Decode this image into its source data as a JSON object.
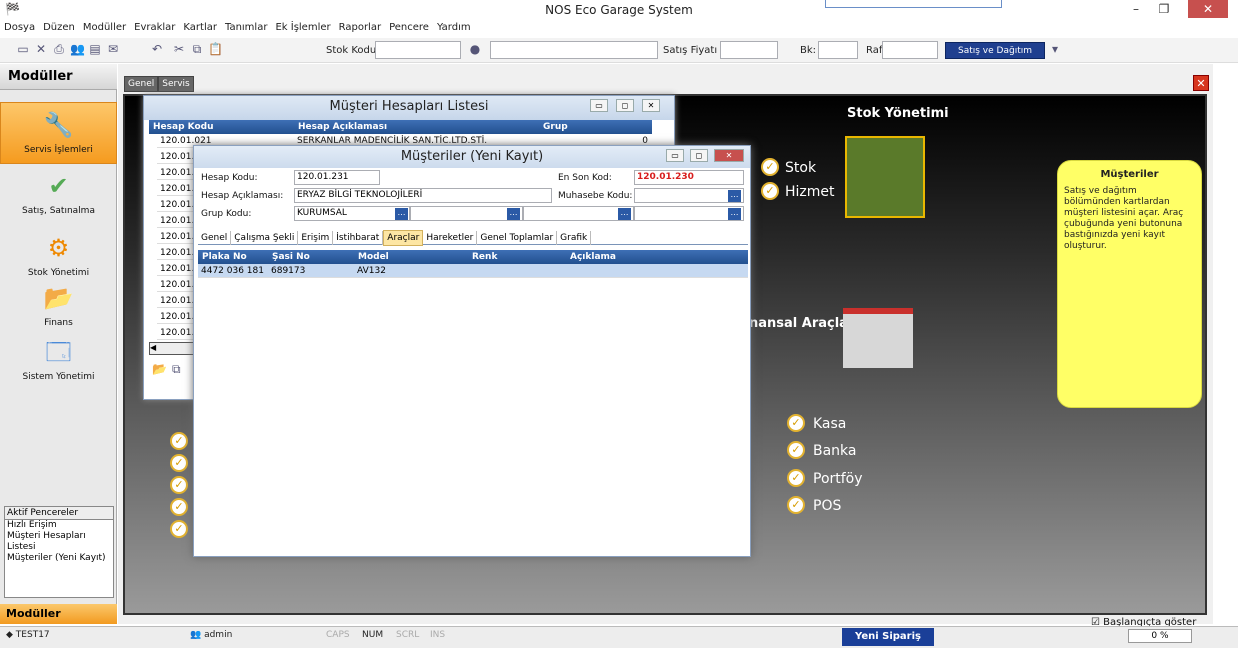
{
  "title": "NOS Eco Garage System",
  "menu": [
    "Dosya",
    "Düzen",
    "Modüller",
    "Evraklar",
    "Kartlar",
    "Tanımlar",
    "Ek İşlemler",
    "Raporlar",
    "Pencere",
    "Yardım"
  ],
  "toolbar": {
    "stok_kodu": "Stok Kodu",
    "satis_fiyati": "Satış Fiyatı",
    "bk": "Bk:",
    "raf": "Raf",
    "satis_dagitim": "Satış ve Dağıtım"
  },
  "sidebar": {
    "header": "Modüller",
    "items": [
      {
        "label": "Servis İşlemleri"
      },
      {
        "label": "Satış, Satınalma"
      },
      {
        "label": "Stok Yönetimi"
      },
      {
        "label": "Finans"
      },
      {
        "label": "Sistem Yönetimi"
      }
    ],
    "aktif_header": "Aktif Pencereler",
    "aktif_items": [
      "Hızlı Erişim",
      "Müşteri Hesapları Listesi",
      "Müşteriler (Yeni Kayıt)"
    ],
    "footer": "Modüller"
  },
  "tabs": [
    "Genel",
    "Servis"
  ],
  "dashboard": {
    "stok_title": "Stok Yönetimi",
    "stok_items": [
      "Stok",
      "Hizmet"
    ],
    "finans_title": "nansal Araçlar",
    "finans_items": [
      "Kasa",
      "Banka",
      "Portföy",
      "POS"
    ],
    "note_title": "Müşteriler",
    "note_body": "Satış ve dağıtım bölümünden kartlardan müşteri listesini açar. Araç çubuğunda yeni butonuna bastığınızda yeni kayıt oluşturur.",
    "show_startup": "Başlangıçta göster"
  },
  "win1": {
    "title": "Müşteri Hesapları Listesi",
    "cols": [
      "Hesap Kodu",
      "Hesap Açıklaması",
      "Grup"
    ],
    "rows": [
      "120.01.021",
      "120.01.",
      "120.01.",
      "120.01.",
      "120.01.",
      "120.01.",
      "120.01.",
      "120.01.",
      "120.01.",
      "120.01.",
      "120.01.",
      "120.01.",
      "120.01."
    ],
    "first_desc": "SERKANLAR MADENCİLİK SAN.TİC.LTD.STİ.",
    "first_grp": "0"
  },
  "win2": {
    "title": "Müşteriler (Yeni Kayıt)",
    "hesap_kodu_lbl": "Hesap Kodu:",
    "hesap_kodu": "120.01.231",
    "en_son_lbl": "En Son Kod:",
    "en_son": "120.01.230",
    "aciklama_lbl": "Hesap Açıklaması:",
    "aciklama": "ERYAZ BİLGİ TEKNOLOJİLERİ",
    "muhasebe_lbl": "Muhasebe Kodu:",
    "grup_lbl": "Grup Kodu:",
    "grup": "KURUMSAL",
    "tabs": [
      "Genel",
      "Çalışma Şekli",
      "Erişim",
      "İstihbarat",
      "Araçlar",
      "Hareketler",
      "Genel Toplamlar",
      "Grafik"
    ],
    "cols": [
      "Plaka No",
      "Şasi No",
      "Model",
      "Renk",
      "Açıklama"
    ],
    "row": {
      "plaka": "4472 036 181",
      "sasi": "689173",
      "model": "AV132",
      "renk": "",
      "aciklama": ""
    }
  },
  "status": {
    "user": "TEST17",
    "admin": "admin",
    "caps": "CAPS",
    "num": "NUM",
    "scrl": "SCRL",
    "ins": "INS",
    "yeni": "Yeni Sipariş",
    "pct": "0 %"
  }
}
